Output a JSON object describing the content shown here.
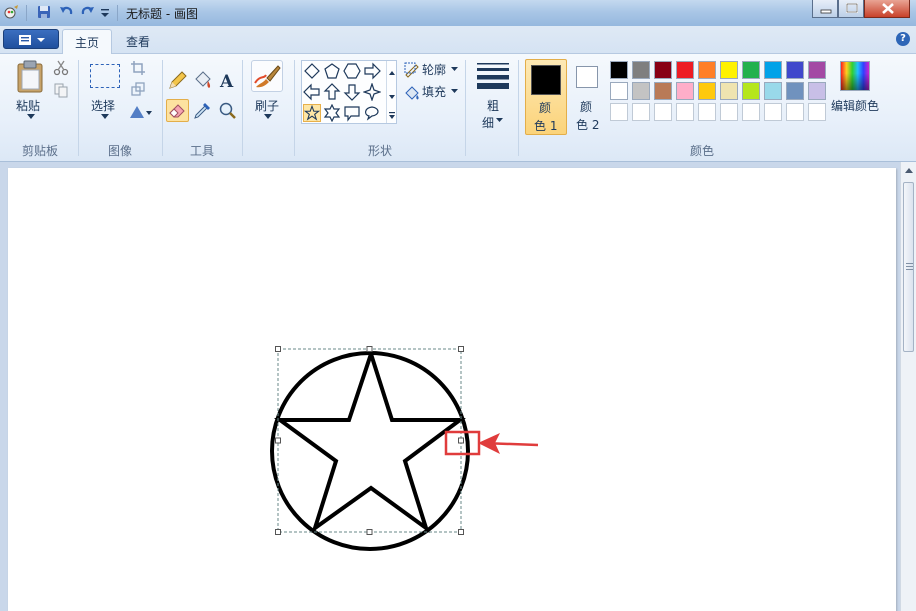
{
  "window": {
    "title": "无标题 - 画图"
  },
  "tabs": [
    {
      "label": "主页",
      "active": true
    },
    {
      "label": "查看",
      "active": false
    }
  ],
  "ribbon": {
    "clipboard": {
      "group_label": "剪贴板",
      "paste_label": "粘贴"
    },
    "image": {
      "group_label": "图像",
      "select_label": "选择"
    },
    "tools": {
      "group_label": "工具"
    },
    "brushes": {
      "label": "刷子"
    },
    "shapes": {
      "group_label": "形状",
      "outline_label": "轮廓",
      "fill_label": "填充"
    },
    "size": {
      "label_line1": "粗",
      "label_line2": "细"
    },
    "colors": {
      "group_label": "颜色",
      "color1_line1": "颜",
      "color1_line2": "色 1",
      "color2_line1": "颜",
      "color2_line2": "色 2",
      "edit_colors_label": "编辑颜色",
      "color1_value": "#000000",
      "color2_value": "#ffffff",
      "palette_row1": [
        "#000000",
        "#7f7f7f",
        "#880015",
        "#ed1c24",
        "#ff7f27",
        "#fff200",
        "#22b14c",
        "#00a2e8",
        "#3f48cc",
        "#a349a4"
      ],
      "palette_row2": [
        "#ffffff",
        "#c3c3c3",
        "#b97a57",
        "#ffaec9",
        "#ffc90e",
        "#efe4b0",
        "#b5e61d",
        "#99d9ea",
        "#7092be",
        "#c8bfe7"
      ],
      "palette_row3": [
        "#ffffff",
        "#ffffff",
        "#ffffff",
        "#ffffff",
        "#ffffff",
        "#ffffff",
        "#ffffff",
        "#ffffff",
        "#ffffff",
        "#ffffff"
      ]
    }
  },
  "annotation": {
    "highlight_color": "#e03c3c"
  }
}
